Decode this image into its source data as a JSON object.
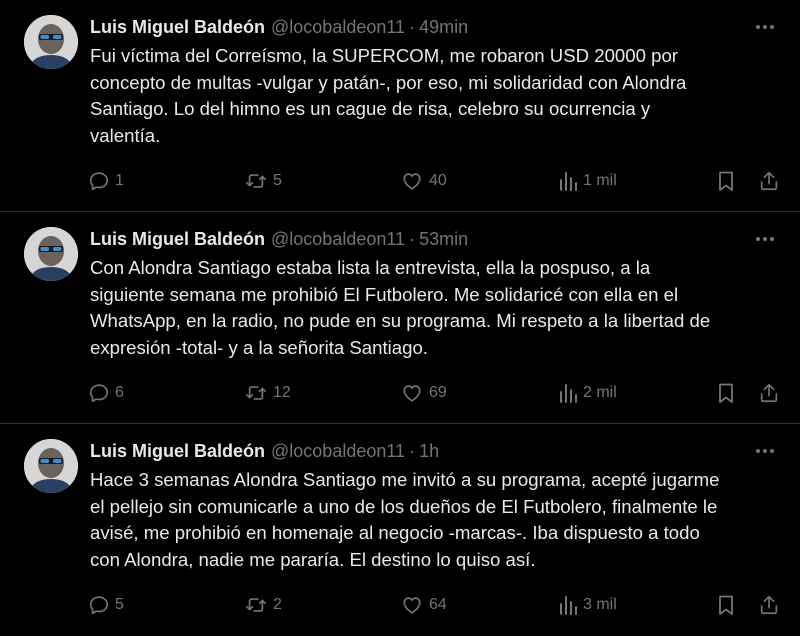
{
  "colors": {
    "background": "#000000",
    "text": "#e7e9ea",
    "secondary": "#71767b",
    "divider": "#2f3336"
  },
  "icons": {
    "reply": "reply-bubble-icon",
    "retweet": "retweet-icon",
    "like": "heart-icon",
    "views": "bar-chart-icon",
    "bookmark": "bookmark-icon",
    "share": "share-upload-icon",
    "more": "more-dots-icon"
  },
  "tweets": [
    {
      "name": "Luis Miguel Baldeón",
      "handle": "@locobaldeon11",
      "separator": "·",
      "time": "49min",
      "text": "Fui víctima del Correísmo, la SUPERCOM, me robaron USD 20000 por\nconcepto de multas -vulgar y patán-, por eso, mi solidaridad con Alondra\nSantiago. Lo del himno es un cague de risa, celebro su ocurrencia y\nvalentía.",
      "replies": "1",
      "retweets": "5",
      "likes": "40",
      "views": "1 mil"
    },
    {
      "name": "Luis Miguel Baldeón",
      "handle": "@locobaldeon11",
      "separator": "·",
      "time": "53min",
      "text": "Con Alondra Santiago estaba lista la entrevista, ella la pospuso, a la\nsiguiente semana me prohibió El Futbolero. Me solidaricé con ella en el\nWhatsApp, en la radio, no pude en su programa. Mi respeto a la libertad de\nexpresión -total- y a la señorita Santiago.",
      "replies": "6",
      "retweets": "12",
      "likes": "69",
      "views": "2 mil"
    },
    {
      "name": "Luis Miguel Baldeón",
      "handle": "@locobaldeon11",
      "separator": "·",
      "time": "1h",
      "text": "Hace 3 semanas Alondra Santiago me invitó a su programa, acepté jugarme\nel pellejo sin comunicarle a uno de los dueños de El Futbolero, finalmente le\navisé, me prohibió en homenaje al negocio -marcas-. Iba dispuesto a todo\ncon Alondra, nadie me pararía. El destino lo quiso así.",
      "replies": "5",
      "retweets": "2",
      "likes": "64",
      "views": "3 mil"
    }
  ]
}
